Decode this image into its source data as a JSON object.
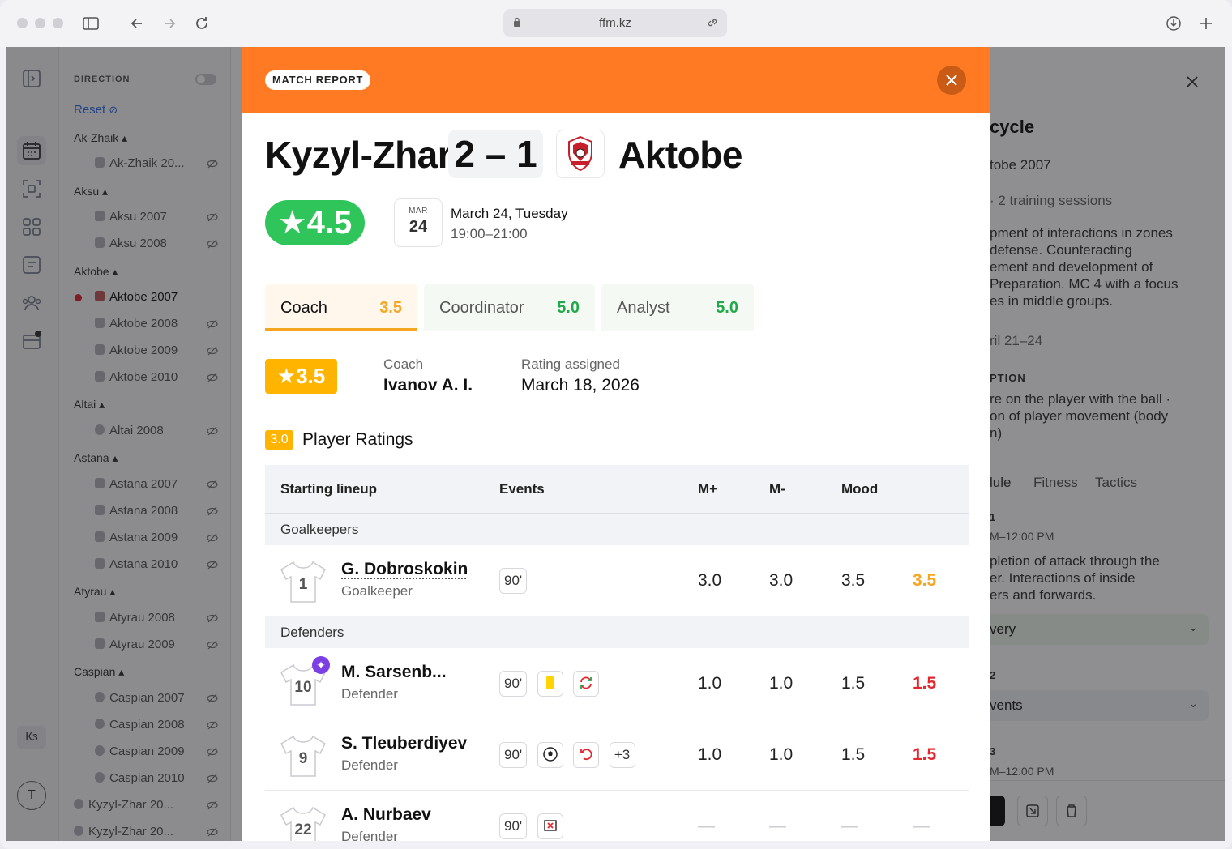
{
  "browser": {
    "url": "ffm.kz"
  },
  "rail": {
    "lang": "Кз",
    "avatar": "T"
  },
  "filters": {
    "title": "DIRECTION",
    "reset": "Reset",
    "groups": [
      {
        "name": "Ak-Zhaik",
        "items": [
          "Ak-Zhaik 20..."
        ]
      },
      {
        "name": "Aksu",
        "items": [
          "Aksu 2007",
          "Aksu 2008"
        ]
      },
      {
        "name": "Aktobe",
        "items": [
          "Aktobe 2007",
          "Aktobe 2008",
          "Aktobe 2009",
          "Aktobe 2010"
        ]
      },
      {
        "name": "Altai",
        "items": [
          "Altai 2008"
        ]
      },
      {
        "name": "Astana",
        "items": [
          "Astana 2007",
          "Astana 2008",
          "Astana 2009",
          "Astana 2010"
        ]
      },
      {
        "name": "Atyrau",
        "items": [
          "Atyrau 2008",
          "Atyrau 2009"
        ]
      },
      {
        "name": "Caspian",
        "items": [
          "Caspian 2007",
          "Caspian 2008",
          "Caspian 2009",
          "Caspian 2010"
        ]
      },
      {
        "name": "",
        "items": [
          "Kyzyl-Zhar 20...",
          "Kyzyl-Zhar 20..."
        ]
      }
    ]
  },
  "right_panel": {
    "title": "cycle",
    "team": "tobe 2007",
    "sessions": "· 2 training sessions",
    "description": [
      "pment of interactions in zones",
      "defense. Counteracting",
      "ement and development of",
      "Preparation. MC 4 with a focus",
      "es in middle groups."
    ],
    "dates": "ril 21–24",
    "section": "PTION",
    "perception": [
      "re on the player with the ball ·",
      "on of player movement (body",
      "n)"
    ],
    "tabs": [
      "lule",
      "Fitness",
      "Tactics"
    ],
    "s1_num": "1",
    "s1_time": "M–12:00 PM",
    "s1_text": [
      "pletion of attack through the",
      "er. Interactions of inside",
      "ers and forwards."
    ],
    "s1_dropdown": "very",
    "s2_num": "2",
    "s2_dropdown": "vents",
    "s3_num": "3",
    "s3_time": "M–12:00 PM"
  },
  "modal": {
    "badge": "MATCH REPORT",
    "home_team": "Kyzyl-Zhar",
    "score": "2 – 1",
    "away_team": "Aktobe",
    "overall_rating": "★4.5",
    "date": {
      "month": "MAR",
      "day": "24",
      "main": "March 24, Tuesday",
      "time": "19:00–21:00"
    },
    "tabs": [
      {
        "label": "Coach",
        "value": "3.5",
        "color": "#f5a623"
      },
      {
        "label": "Coordinator",
        "value": "5.0",
        "color": "#21a84a"
      },
      {
        "label": "Analyst",
        "value": "5.0",
        "color": "#21a84a"
      }
    ],
    "rater": {
      "rating": "★3.5",
      "role_label": "Coach",
      "name": "Ivanov A. I.",
      "assigned_label": "Rating assigned",
      "assigned_date": "March 18, 2026"
    },
    "player_ratings": {
      "badge": "3.0",
      "title": "Player Ratings"
    },
    "table": {
      "headers": [
        "Starting lineup",
        "Events",
        "M+",
        "M-",
        "Mood"
      ],
      "groups": [
        "Goalkeepers",
        "Defenders"
      ],
      "players": [
        {
          "number": "1",
          "name": "G. Dobroskokin",
          "position": "Goalkeeper",
          "events": [
            "90'"
          ],
          "m_plus": "3.0",
          "m_minus": "3.0",
          "mood": "3.5",
          "final": "3.5",
          "final_color": "#f5a623"
        },
        {
          "number": "10",
          "name": "M. Sarsenb...",
          "position": "Defender",
          "events": [
            "90'",
            "yellow-card-icon",
            "substitution-icon"
          ],
          "m_plus": "1.0",
          "m_minus": "1.0",
          "mood": "1.5",
          "final": "1.5",
          "final_color": "#e5262f"
        },
        {
          "number": "9",
          "name": "S. Tleuberdiyev",
          "position": "Defender",
          "events": [
            "90'",
            "ball-icon",
            "sub-out-icon",
            "+3"
          ],
          "m_plus": "1.0",
          "m_minus": "1.0",
          "mood": "1.5",
          "final": "1.5",
          "final_color": "#e5262f"
        },
        {
          "number": "22",
          "name": "A. Nurbaev",
          "position": "Defender",
          "events": [
            "90'",
            "missed-icon"
          ],
          "m_plus": "—",
          "m_minus": "—",
          "mood": "—",
          "final": "—",
          "final_color": "#c8c8ce"
        }
      ]
    }
  }
}
